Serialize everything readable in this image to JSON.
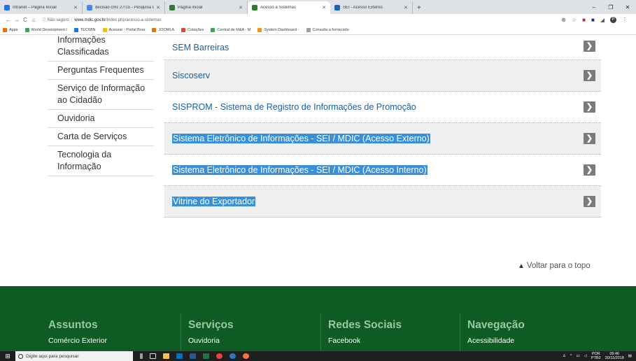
{
  "browser": {
    "tabs": [
      {
        "label": "Intranet – Página Inicial",
        "color": "#1a73e8",
        "active": false
      },
      {
        "label": "decisão cmc 27/15 - Pesquisa Go",
        "color": "#4285f4",
        "active": false
      },
      {
        "label": "Página inicial",
        "color": "#2e7d32",
        "active": false
      },
      {
        "label": "Acesso a Sistemas",
        "color": "#2e7d32",
        "active": true
      },
      {
        "label": "SEI - Acesso Externo",
        "color": "#1565c0",
        "active": false
      }
    ],
    "new_tab_label": "+",
    "address": {
      "security": "Não seguro",
      "host": "www.mdic.gov.br",
      "path": "/index.php/acesso-a-sistemas"
    },
    "profile_initial": "P",
    "bookmarks": [
      {
        "label": "Apps",
        "color": "#e8710a"
      },
      {
        "label": "World Development I",
        "color": "#34a853"
      },
      {
        "label": "TECWIN",
        "color": "#1a73e8"
      },
      {
        "label": "Acessar - Portal Bras",
        "color": "#fbbc04"
      },
      {
        "label": "JOOMLA",
        "color": "#e37400"
      },
      {
        "label": "Cotações",
        "color": "#ea4335"
      },
      {
        "label": "Central de M&A - M",
        "color": "#34a853"
      },
      {
        "label": "System Dashboard -",
        "color": "#f29900"
      },
      {
        "label": "Consulta a fornecedo",
        "color": "#9aa0a6"
      }
    ]
  },
  "sidebar": {
    "items": [
      {
        "label": "Informações Classificadas"
      },
      {
        "label": "Perguntas Frequentes"
      },
      {
        "label": "Serviço de Informação ao Cidadão"
      },
      {
        "label": "Ouvidoria"
      },
      {
        "label": "Carta de Serviços"
      },
      {
        "label": "Tecnologia da Informação"
      }
    ]
  },
  "systems": {
    "arrow_glyph": "❯",
    "items": [
      {
        "label": "SEM Barreiras",
        "selected": false
      },
      {
        "label": "Siscoserv",
        "selected": false
      },
      {
        "label": "SISPROM - Sistema de Registro de Informações de Promoção",
        "selected": false
      },
      {
        "label": "Sistema Eletrônico de Informações - SEI / MDIC (Acesso Externo)",
        "selected": true
      },
      {
        "label": "Sistema Eletrônico de Informações - SEI / MDIC (Acesso Interno)",
        "selected": true
      },
      {
        "label": "Vitrine do Exportador",
        "selected": true
      }
    ]
  },
  "back_to_top": "Voltar para o topo",
  "footer": {
    "columns": [
      {
        "heading": "Assuntos",
        "item": "Comércio Exterior"
      },
      {
        "heading": "Serviços",
        "item": "Ouvidoria"
      },
      {
        "heading": "Redes Sociais",
        "item": "Facebook"
      },
      {
        "heading": "Navegação",
        "item": "Acessibilidade"
      }
    ]
  },
  "taskbar": {
    "search_placeholder": "Digite aqui para pesquisar",
    "language": "POR",
    "language_sub": "PTB2",
    "time": "09:46",
    "date": "30/11/2018"
  }
}
